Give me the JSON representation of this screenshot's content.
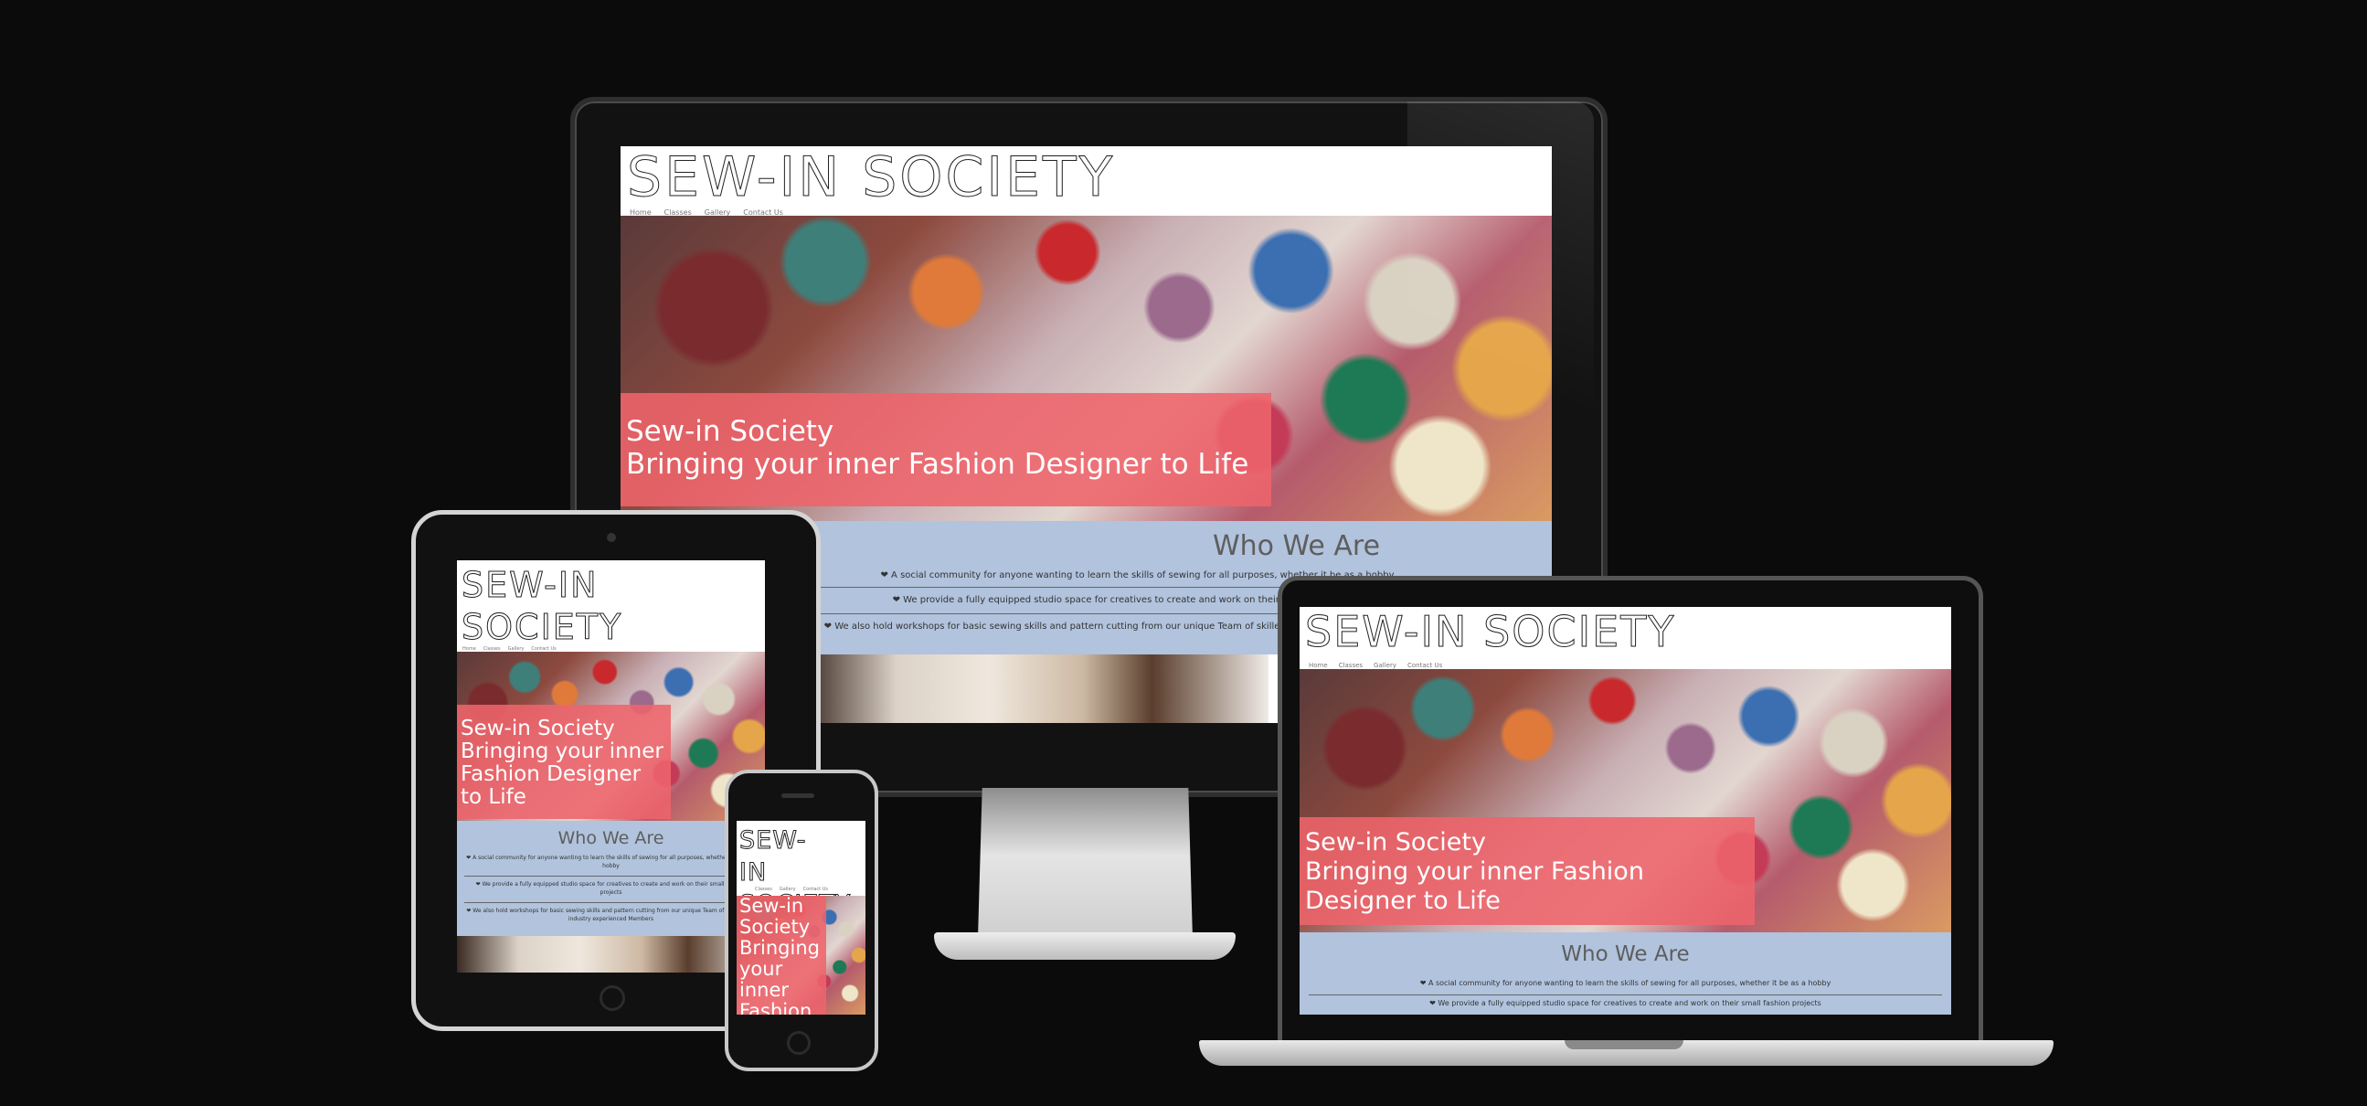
{
  "site": {
    "brand": "SEW-IN SOCIETY",
    "nav": [
      "Home",
      "Classes",
      "Gallery",
      "Contact Us"
    ],
    "hero_title": "Sew-in Society",
    "hero_subtitle": "Bringing your inner Fashion Designer to Life",
    "about_heading": "Who We Are",
    "about_items": [
      "❤ A social community for anyone wanting to learn the skills of sewing for all purposes, whether it be as a hobby",
      "❤ We provide a fully equipped studio space for creatives to create and work on their small fashion projects",
      "❤ We also hold workshops for basic sewing skills and pattern cutting from our unique Team of skilled and industry experienced Members"
    ]
  },
  "devices": [
    "desktop-monitor",
    "tablet",
    "smartphone",
    "laptop"
  ],
  "colors": {
    "background": "#0c0b0c",
    "hero_band": "#ee646b",
    "about_bg": "#b1c3dd"
  }
}
